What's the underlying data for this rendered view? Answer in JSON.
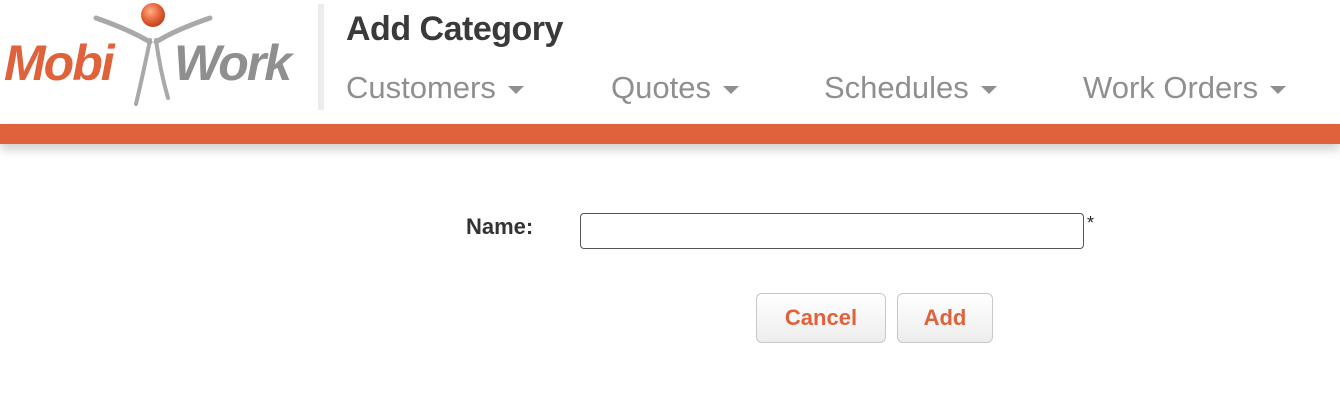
{
  "brand": {
    "logo_text_left": "Mobi",
    "logo_text_right": "Work",
    "accent_color": "#e0623a",
    "logo_gray": "#8f8f8f"
  },
  "header": {
    "title": "Add Category"
  },
  "nav": {
    "items": [
      {
        "label": "Customers",
        "icon": "caret-down-icon"
      },
      {
        "label": "Quotes",
        "icon": "caret-down-icon"
      },
      {
        "label": "Schedules",
        "icon": "caret-down-icon"
      },
      {
        "label": "Work Orders",
        "icon": "caret-down-icon"
      }
    ]
  },
  "form": {
    "name_label": "Name:",
    "name_value": "",
    "required_mark": "*",
    "cancel_label": "Cancel",
    "add_label": "Add"
  }
}
